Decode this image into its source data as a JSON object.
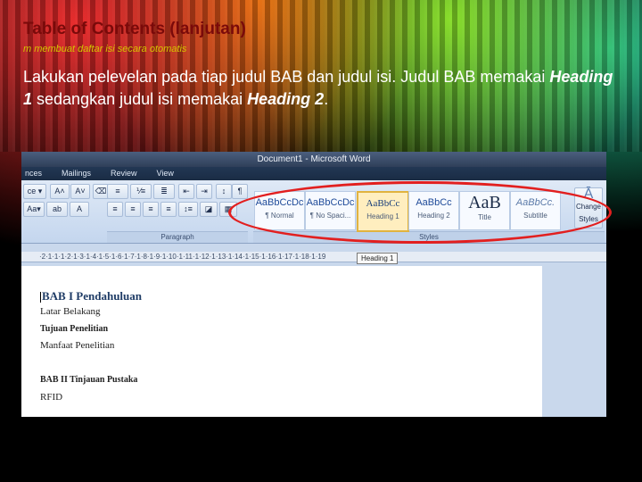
{
  "slide": {
    "title": "Table of Contents (lanjutan)",
    "subtitle": "m membuat daftar isi secara otomatis",
    "body_text": "Lakukan pelevelan pada tiap judul BAB dan judul isi. Judul BAB memakai ",
    "heading1_emph": "Heading 1",
    "body_middle": " sedangkan judul isi memakai ",
    "heading2_emph": "Heading 2",
    "body_end": "."
  },
  "word": {
    "window_title": "Document1 - Microsoft Word",
    "tabs": [
      "nces",
      "Mailings",
      "Review",
      "View"
    ],
    "paragraph_group_label": "Paragraph",
    "styles_group_label": "Styles",
    "change_styles_label": "Change Styles",
    "styles": [
      {
        "sample": "AaBbCcDc",
        "name": "¶ Normal"
      },
      {
        "sample": "AaBbCcDc",
        "name": "¶ No Spaci..."
      },
      {
        "sample": "AaBbCc",
        "name": "Heading 1"
      },
      {
        "sample": "AaBbCc",
        "name": "Heading 2"
      },
      {
        "sample": "AaB",
        "name": "Title"
      },
      {
        "sample": "AaBbCc.",
        "name": "Subtitle"
      }
    ],
    "tooltip": "Heading 1",
    "ruler": "·2·1·1·1·2·1·3·1·4·1·5·1·6·1·7·1·8·1·9·1·10·1·11·1·12·1·13·1·14·1·15·1·16·1·17·1·18·1·19",
    "doc_lines": [
      "BAB I Pendahuluan",
      "Latar Belakang",
      "Tujuan Penelitian",
      "Manfaat Penelitian",
      "BAB II Tinjauan Pustaka",
      "RFID"
    ]
  },
  "colors": {
    "highlight_oval": "#e21f1f",
    "title_color": "#7a0a0a",
    "subtitle_color": "#d4c400"
  }
}
